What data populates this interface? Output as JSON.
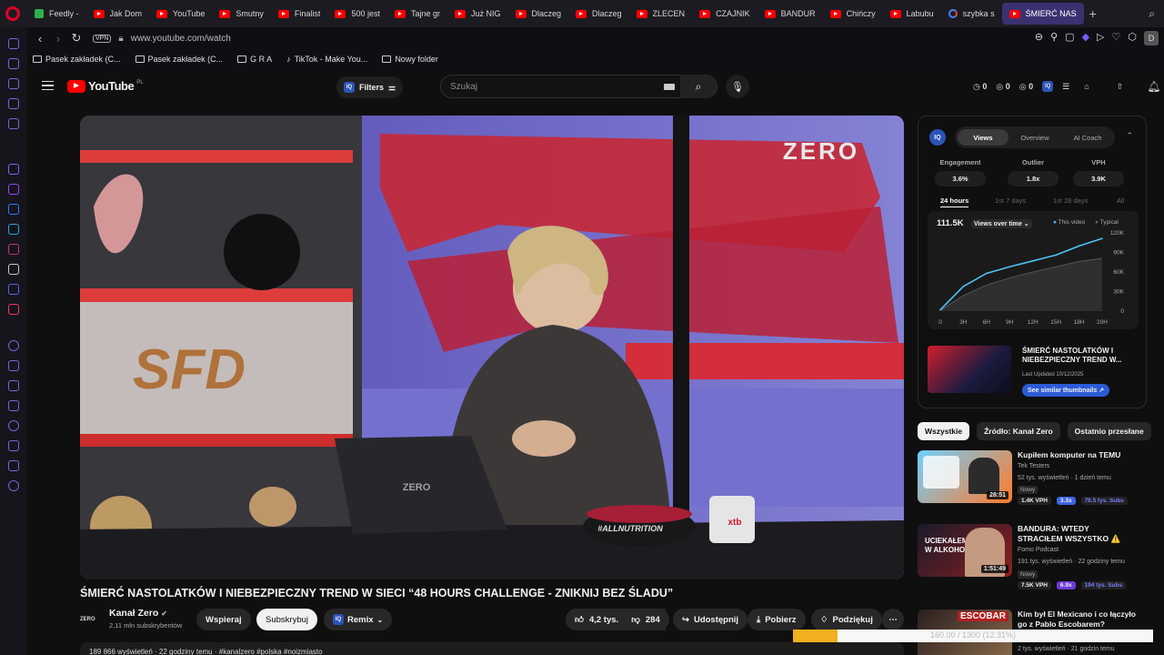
{
  "browser": {
    "tabs": [
      {
        "label": "Feedly -",
        "kind": "feedly"
      },
      {
        "label": "Jak Dom",
        "kind": "yt"
      },
      {
        "label": "YouTube",
        "kind": "yt"
      },
      {
        "label": "Smutny",
        "kind": "yt"
      },
      {
        "label": "Finalist",
        "kind": "yt"
      },
      {
        "label": "500 jest",
        "kind": "yt"
      },
      {
        "label": "Tajne gr",
        "kind": "yt"
      },
      {
        "label": "Już NIG",
        "kind": "yt"
      },
      {
        "label": "Dlaczeg",
        "kind": "yt"
      },
      {
        "label": "Dlaczeg",
        "kind": "yt"
      },
      {
        "label": "ZLECEN",
        "kind": "yt"
      },
      {
        "label": "CZAJNIK",
        "kind": "yt"
      },
      {
        "label": "BANDUR",
        "kind": "yt"
      },
      {
        "label": "Chińczy",
        "kind": "yt"
      },
      {
        "label": "Labubu",
        "kind": "yt"
      },
      {
        "label": "szybka s",
        "kind": "google"
      },
      {
        "label": "ŚMIERĆ NAS",
        "kind": "yt",
        "active": true
      }
    ],
    "new_tab": "+",
    "url": "www.youtube.com/watch",
    "vpn": "VPN",
    "profile": "D",
    "bookmarks": [
      {
        "label": "Pasek zakładek (C...",
        "icon": "folder"
      },
      {
        "label": "Pasek zakładek (C...",
        "icon": "folder"
      },
      {
        "label": "G R A",
        "icon": "folder"
      },
      {
        "label": "TikTok - Make You...",
        "icon": "tiktok"
      },
      {
        "label": "Nowy folder",
        "icon": "folder"
      }
    ]
  },
  "youtube": {
    "logo": "YouTube",
    "country": "PL",
    "filters": "Filters",
    "iq_badge": "IQ",
    "search_placeholder": "Szukaj",
    "counters": [
      "0",
      "0",
      "0"
    ]
  },
  "video": {
    "title": "ŚMIERĆ NASTOLATKÓW I NIEBEZPIECZNY TREND W SIECI “48 HOURS CHALLENGE - ZNIKNIJ BEZ ŚLADU”",
    "overlay_zero": "ZERO",
    "overlay_sfd": "SFD",
    "overlay_laptop": "ZERO",
    "overlay_bowl": "#ALLNUTRITION",
    "overlay_mug": "xtb",
    "channel": {
      "logo": "ZERO",
      "name": "Kanał Zero",
      "subs": "2,11 mln subskrybentów"
    },
    "actions": {
      "support": "Wspieraj",
      "subscribe": "Subskrybuj",
      "remix": "Remix",
      "likes": "4,2 tys.",
      "dislikes": "284",
      "share": "Udostępnij",
      "download": "Pobierz",
      "thanks": "Podziękuj",
      "more": "⋯"
    },
    "description_line": "189 866 wyświetleń · 22 godziny temu · #kanalzero #polska #noizmiasto"
  },
  "iq_panel": {
    "badge": "IQ",
    "tabs": [
      "Views",
      "Overview",
      "AI Coach"
    ],
    "active_tab": "Views",
    "metrics": [
      {
        "label": "Engagement",
        "value": "3.6%"
      },
      {
        "label": "Outlier",
        "value": "1.8x"
      },
      {
        "label": "VPH",
        "value": "3.9K"
      }
    ],
    "periods": [
      "24 hours",
      "1st 7 days",
      "1st 28 days",
      "All"
    ],
    "active_period": "24 hours",
    "total": "111.5K",
    "total_label": "Views over time",
    "legend": [
      "This video",
      "Typical"
    ],
    "card": {
      "title": "ŚMIERĆ NASTOLATKÓW I NIEBEZPIECZNY TREND W...",
      "updated": "Last Updated 10/12/2025",
      "button": "See similar thumbnails ↗"
    }
  },
  "chart_data": {
    "type": "area",
    "x": [
      "0",
      "3H",
      "6H",
      "9H",
      "12H",
      "15H",
      "18H",
      "20H"
    ],
    "ylabels": [
      "0",
      "30K",
      "60K",
      "90K",
      "120K"
    ],
    "ylim": [
      0,
      120000
    ],
    "series": [
      {
        "name": "This video",
        "values": [
          2000,
          38000,
          58000,
          68000,
          77000,
          86000,
          100000,
          111500
        ]
      },
      {
        "name": "Typical",
        "values": [
          1000,
          24000,
          40000,
          51000,
          60000,
          68000,
          76000,
          81000
        ]
      }
    ],
    "colors": {
      "this": "#4fc3f7",
      "typical": "#555555"
    }
  },
  "related": {
    "chips": [
      "Wszystkie",
      "Źródło: Kanał Zero",
      "Ostatnio przesłane"
    ],
    "items": [
      {
        "title": "Kupiłem komputer na TEMU",
        "channel": "Tek Testers",
        "meta": "52 tys. wyświetleń · 1 dzień temu",
        "badge": "Nowy",
        "duration": "28:51",
        "vph": "1.4K VPH",
        "x": "3.3x",
        "subs": "78.5 tys. Subs",
        "thumb": "temu"
      },
      {
        "title": "BANDURA: WTEDY STRACIŁEM WSZYSTKO ⚠️",
        "channel": "Fomo Podcast",
        "meta": "191 tys. wyświetleń · 22 godziny temu",
        "badge": "Nowy",
        "duration": "1:51:49",
        "vph": "7.5K VPH",
        "x": "6.9x",
        "subs": "194 tys. Subs",
        "thumb": "bandura",
        "thumb_text": "UCIEKAŁEM W ALKOHOL"
      },
      {
        "title": "Kim był El Mexicano i co łączyło go z Pablo Escobarem?",
        "channel": "",
        "meta": "2 tys. wyświetleń · 21 godzin temu",
        "badge": "",
        "duration": "",
        "vph": "",
        "x": "",
        "subs": "",
        "thumb": "escobar",
        "thumb_text": "ESCOBAR"
      }
    ]
  },
  "progress": {
    "text": "160.00 / 1300 (12.31%)",
    "fraction": 0.1231
  }
}
